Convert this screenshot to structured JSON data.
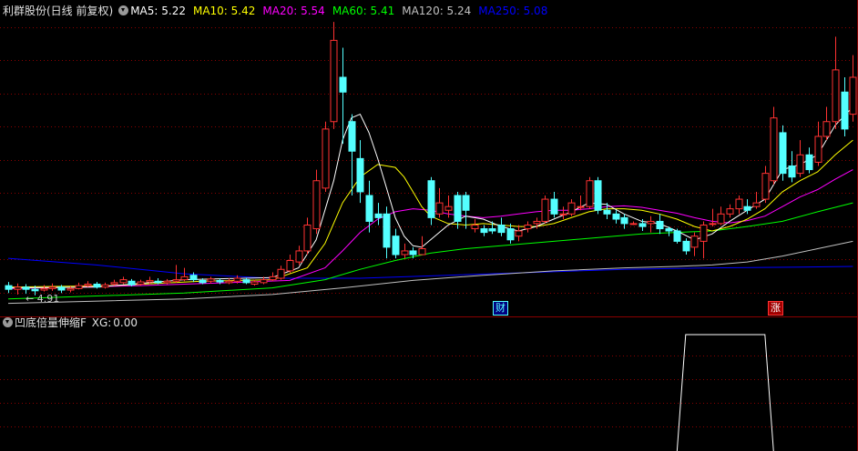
{
  "main_legend": {
    "title": "利群股份(日线 前复权)",
    "ma_items": [
      {
        "label": "MA5:",
        "value": "5.22",
        "color": "#ffffff"
      },
      {
        "label": "MA10:",
        "value": "5.42",
        "color": "#ffff00"
      },
      {
        "label": "MA20:",
        "value": "5.54",
        "color": "#ff00ff"
      },
      {
        "label": "MA60:",
        "value": "5.41",
        "color": "#00ff00"
      },
      {
        "label": "MA120:",
        "value": "5.24",
        "color": "#c0c0c0"
      },
      {
        "label": "MA250:",
        "value": "5.08",
        "color": "#0000ff"
      }
    ]
  },
  "sub_legend": {
    "title": "凹底倍量伸缩F",
    "xg_label": "XG:",
    "xg_value": "0.00"
  },
  "annotations": {
    "low_marker": "← 4.91",
    "badge_cai": "财",
    "badge_zhang": "涨"
  },
  "colors": {
    "up": "#ff3232",
    "down": "#54ffff",
    "grid": "#8b0000",
    "background": "#000000"
  },
  "chart_data": [
    {
      "type": "candlestick",
      "title": "利群股份(日线 前复权)",
      "ylim": [
        4.6,
        8.6
      ],
      "candles": [
        [
          4.98,
          4.93,
          5.03,
          4.88
        ],
        [
          4.93,
          4.96,
          5.01,
          4.86
        ],
        [
          4.96,
          4.93,
          5.0,
          4.87
        ],
        [
          4.93,
          4.91,
          4.98,
          4.85
        ],
        [
          4.92,
          4.94,
          4.99,
          4.9
        ],
        [
          4.94,
          4.96,
          5.01,
          4.91
        ],
        [
          4.96,
          4.92,
          4.99,
          4.88
        ],
        [
          4.92,
          4.94,
          4.97,
          4.89
        ],
        [
          4.94,
          4.98,
          5.02,
          4.93
        ],
        [
          4.98,
          5.0,
          5.04,
          4.96
        ],
        [
          5.0,
          4.96,
          5.03,
          4.94
        ],
        [
          4.96,
          4.99,
          5.02,
          4.94
        ],
        [
          5.0,
          5.02,
          5.06,
          4.98
        ],
        [
          5.02,
          5.06,
          5.1,
          5.0
        ],
        [
          5.04,
          4.99,
          5.07,
          4.97
        ],
        [
          5.0,
          5.03,
          5.06,
          4.98
        ],
        [
          5.03,
          5.05,
          5.1,
          5.0
        ],
        [
          5.04,
          5.02,
          5.08,
          5.0
        ],
        [
          5.02,
          5.04,
          5.07,
          5.0
        ],
        [
          5.04,
          5.06,
          5.26,
          5.02
        ],
        [
          5.06,
          5.1,
          5.22,
          5.04
        ],
        [
          5.12,
          5.06,
          5.16,
          5.03
        ],
        [
          5.05,
          5.02,
          5.08,
          5.0
        ],
        [
          5.04,
          5.07,
          5.1,
          5.01
        ],
        [
          5.05,
          5.03,
          5.08,
          5.0
        ],
        [
          5.02,
          5.04,
          5.08,
          5.0
        ],
        [
          5.04,
          5.08,
          5.12,
          5.01
        ],
        [
          5.06,
          5.02,
          5.09,
          5.0
        ],
        [
          5.0,
          5.03,
          5.06,
          4.98
        ],
        [
          5.02,
          5.06,
          5.1,
          5.0
        ],
        [
          5.06,
          5.1,
          5.16,
          5.04
        ],
        [
          5.08,
          5.2,
          5.25,
          5.06
        ],
        [
          5.18,
          5.32,
          5.4,
          5.15
        ],
        [
          5.3,
          5.45,
          5.52,
          5.26
        ],
        [
          5.45,
          5.8,
          5.9,
          5.4
        ],
        [
          5.75,
          6.4,
          6.55,
          5.68
        ],
        [
          6.3,
          7.1,
          7.2,
          6.25
        ],
        [
          7.2,
          8.3,
          8.55,
          7.1
        ],
        [
          7.8,
          7.6,
          8.2,
          6.9
        ],
        [
          7.2,
          6.8,
          7.3,
          6.2
        ],
        [
          6.7,
          6.25,
          6.95,
          6.1
        ],
        [
          6.2,
          5.85,
          6.4,
          5.7
        ],
        [
          5.95,
          5.9,
          6.1,
          5.8
        ],
        [
          5.95,
          5.5,
          6.05,
          5.35
        ],
        [
          5.65,
          5.4,
          5.75,
          5.35
        ],
        [
          5.4,
          5.45,
          5.55,
          5.35
        ],
        [
          5.45,
          5.4,
          5.5,
          5.35
        ],
        [
          5.4,
          5.48,
          5.65,
          5.4
        ],
        [
          6.4,
          5.9,
          6.45,
          5.8
        ],
        [
          5.95,
          6.1,
          6.3,
          5.9
        ],
        [
          6.0,
          6.05,
          6.2,
          5.9
        ],
        [
          6.2,
          5.85,
          6.25,
          5.75
        ],
        [
          6.2,
          6.0,
          6.25,
          5.75
        ],
        [
          5.75,
          5.8,
          5.88,
          5.7
        ],
        [
          5.75,
          5.7,
          5.8,
          5.65
        ],
        [
          5.75,
          5.72,
          5.85,
          5.68
        ],
        [
          5.8,
          5.7,
          5.9,
          5.65
        ],
        [
          5.75,
          5.6,
          5.82,
          5.55
        ],
        [
          5.65,
          5.72,
          5.8,
          5.58
        ],
        [
          5.75,
          5.8,
          5.85,
          5.7
        ],
        [
          5.82,
          5.85,
          5.9,
          5.75
        ],
        [
          5.85,
          6.15,
          6.2,
          5.82
        ],
        [
          6.15,
          5.95,
          6.25,
          5.9
        ],
        [
          5.95,
          5.95,
          6.05,
          5.88
        ],
        [
          5.95,
          6.1,
          6.15,
          5.92
        ],
        [
          6.05,
          6.05,
          6.2,
          6.0
        ],
        [
          6.05,
          6.4,
          6.45,
          6.02
        ],
        [
          6.4,
          6.0,
          6.45,
          5.95
        ],
        [
          6.0,
          5.95,
          6.1,
          5.88
        ],
        [
          5.95,
          5.88,
          6.0,
          5.82
        ],
        [
          5.9,
          5.82,
          5.95,
          5.75
        ],
        [
          5.82,
          5.82,
          5.85,
          5.8
        ],
        [
          5.82,
          5.78,
          5.88,
          5.72
        ],
        [
          5.82,
          5.85,
          5.92,
          5.7
        ],
        [
          5.85,
          5.75,
          5.95,
          5.68
        ],
        [
          5.75,
          5.72,
          5.78,
          5.65
        ],
        [
          5.72,
          5.58,
          5.75,
          5.55
        ],
        [
          5.58,
          5.45,
          5.62,
          5.4
        ],
        [
          5.5,
          5.65,
          5.7,
          5.38
        ],
        [
          5.58,
          5.8,
          5.85,
          5.35
        ],
        [
          5.82,
          5.82,
          6.02,
          5.78
        ],
        [
          5.82,
          5.95,
          6.05,
          5.8
        ],
        [
          5.95,
          6.02,
          6.08,
          5.9
        ],
        [
          6.02,
          6.15,
          6.2,
          5.95
        ],
        [
          6.05,
          6.0,
          6.15,
          5.95
        ],
        [
          6.05,
          6.1,
          6.25,
          6.02
        ],
        [
          6.15,
          6.5,
          6.6,
          6.1
        ],
        [
          6.4,
          7.25,
          7.4,
          6.35
        ],
        [
          7.05,
          6.5,
          7.15,
          6.4
        ],
        [
          6.6,
          6.45,
          6.8,
          6.38
        ],
        [
          6.5,
          6.75,
          6.95,
          6.45
        ],
        [
          6.75,
          6.55,
          6.85,
          6.5
        ],
        [
          6.65,
          7.0,
          7.2,
          6.6
        ],
        [
          7.0,
          7.2,
          7.4,
          6.95
        ],
        [
          7.2,
          7.9,
          8.35,
          7.1
        ],
        [
          7.6,
          7.1,
          7.8,
          7.0
        ],
        [
          7.3,
          7.8,
          8.1,
          7.2
        ]
      ],
      "ma": {
        "MA5": [
          [
            0,
            4.95
          ],
          [
            10,
            4.96
          ],
          [
            20,
            5.06
          ],
          [
            30,
            5.09
          ],
          [
            33,
            5.22
          ],
          [
            35,
            5.6
          ],
          [
            37,
            6.4
          ],
          [
            38,
            6.95
          ],
          [
            39,
            7.25
          ],
          [
            40,
            7.3
          ],
          [
            41,
            7.05
          ],
          [
            42,
            6.7
          ],
          [
            43,
            6.3
          ],
          [
            44,
            5.9
          ],
          [
            45,
            5.65
          ],
          [
            46,
            5.52
          ],
          [
            47,
            5.5
          ],
          [
            48,
            5.6
          ],
          [
            49,
            5.7
          ],
          [
            50,
            5.8
          ],
          [
            52,
            5.92
          ],
          [
            54,
            5.88
          ],
          [
            56,
            5.78
          ],
          [
            58,
            5.72
          ],
          [
            60,
            5.78
          ],
          [
            62,
            5.88
          ],
          [
            64,
            5.98
          ],
          [
            66,
            6.1
          ],
          [
            68,
            6.08
          ],
          [
            70,
            5.95
          ],
          [
            72,
            5.85
          ],
          [
            74,
            5.82
          ],
          [
            76,
            5.72
          ],
          [
            78,
            5.6
          ],
          [
            80,
            5.68
          ],
          [
            82,
            5.85
          ],
          [
            84,
            6.0
          ],
          [
            86,
            6.15
          ],
          [
            88,
            6.55
          ],
          [
            90,
            6.62
          ],
          [
            92,
            6.75
          ],
          [
            94,
            7.15
          ],
          [
            96,
            7.4
          ]
        ],
        "MA10": [
          [
            0,
            4.96
          ],
          [
            12,
            4.98
          ],
          [
            22,
            5.04
          ],
          [
            30,
            5.06
          ],
          [
            34,
            5.22
          ],
          [
            36,
            5.55
          ],
          [
            38,
            6.1
          ],
          [
            40,
            6.45
          ],
          [
            42,
            6.62
          ],
          [
            44,
            6.58
          ],
          [
            45,
            6.45
          ],
          [
            46,
            6.25
          ],
          [
            47,
            6.05
          ],
          [
            48,
            5.92
          ],
          [
            50,
            5.82
          ],
          [
            52,
            5.8
          ],
          [
            54,
            5.82
          ],
          [
            56,
            5.8
          ],
          [
            58,
            5.78
          ],
          [
            60,
            5.78
          ],
          [
            62,
            5.82
          ],
          [
            64,
            5.9
          ],
          [
            66,
            5.98
          ],
          [
            68,
            6.02
          ],
          [
            70,
            6.02
          ],
          [
            72,
            6.0
          ],
          [
            74,
            5.95
          ],
          [
            76,
            5.88
          ],
          [
            78,
            5.78
          ],
          [
            80,
            5.72
          ],
          [
            82,
            5.78
          ],
          [
            84,
            5.88
          ],
          [
            86,
            6.02
          ],
          [
            88,
            6.25
          ],
          [
            90,
            6.4
          ],
          [
            92,
            6.52
          ],
          [
            94,
            6.75
          ],
          [
            96,
            6.95
          ]
        ],
        "MA20": [
          [
            0,
            4.94
          ],
          [
            15,
            4.98
          ],
          [
            25,
            5.02
          ],
          [
            32,
            5.05
          ],
          [
            36,
            5.22
          ],
          [
            38,
            5.45
          ],
          [
            40,
            5.7
          ],
          [
            42,
            5.88
          ],
          [
            44,
            5.98
          ],
          [
            46,
            6.02
          ],
          [
            48,
            6.0
          ],
          [
            50,
            5.95
          ],
          [
            52,
            5.92
          ],
          [
            54,
            5.9
          ],
          [
            56,
            5.92
          ],
          [
            58,
            5.95
          ],
          [
            60,
            5.98
          ],
          [
            62,
            6.0
          ],
          [
            64,
            6.0
          ],
          [
            66,
            6.02
          ],
          [
            68,
            6.05
          ],
          [
            70,
            6.06
          ],
          [
            72,
            6.04
          ],
          [
            74,
            6.0
          ],
          [
            76,
            5.96
          ],
          [
            78,
            5.9
          ],
          [
            80,
            5.85
          ],
          [
            82,
            5.83
          ],
          [
            84,
            5.86
          ],
          [
            86,
            5.92
          ],
          [
            88,
            6.05
          ],
          [
            90,
            6.18
          ],
          [
            92,
            6.28
          ],
          [
            94,
            6.42
          ],
          [
            96,
            6.55
          ]
        ],
        "MA60": [
          [
            0,
            4.8
          ],
          [
            20,
            4.88
          ],
          [
            30,
            4.95
          ],
          [
            36,
            5.06
          ],
          [
            40,
            5.2
          ],
          [
            44,
            5.32
          ],
          [
            48,
            5.42
          ],
          [
            52,
            5.48
          ],
          [
            56,
            5.52
          ],
          [
            60,
            5.56
          ],
          [
            64,
            5.6
          ],
          [
            68,
            5.64
          ],
          [
            72,
            5.68
          ],
          [
            76,
            5.7
          ],
          [
            80,
            5.72
          ],
          [
            84,
            5.78
          ],
          [
            88,
            5.85
          ],
          [
            92,
            5.98
          ],
          [
            96,
            6.1
          ]
        ],
        "MA120": [
          [
            0,
            4.74
          ],
          [
            20,
            4.8
          ],
          [
            30,
            4.86
          ],
          [
            38,
            4.95
          ],
          [
            46,
            5.05
          ],
          [
            54,
            5.12
          ],
          [
            62,
            5.18
          ],
          [
            70,
            5.22
          ],
          [
            76,
            5.24
          ],
          [
            80,
            5.26
          ],
          [
            84,
            5.3
          ],
          [
            88,
            5.38
          ],
          [
            92,
            5.48
          ],
          [
            96,
            5.58
          ]
        ],
        "MA250": [
          [
            0,
            5.35
          ],
          [
            10,
            5.26
          ],
          [
            20,
            5.14
          ],
          [
            30,
            5.08
          ],
          [
            40,
            5.08
          ],
          [
            50,
            5.12
          ],
          [
            60,
            5.16
          ],
          [
            70,
            5.2
          ],
          [
            80,
            5.22
          ],
          [
            90,
            5.23
          ],
          [
            96,
            5.24
          ]
        ]
      },
      "low_marker_value": 4.91
    },
    {
      "type": "line",
      "title": "凹底倍量伸缩F",
      "series": [
        {
          "values": [
            [
              0,
              0
            ],
            [
              76,
              0
            ],
            [
              77,
              1
            ],
            [
              86,
              1
            ],
            [
              87,
              0
            ],
            [
              96,
              0
            ]
          ]
        }
      ],
      "ylim": [
        0,
        1
      ]
    }
  ]
}
